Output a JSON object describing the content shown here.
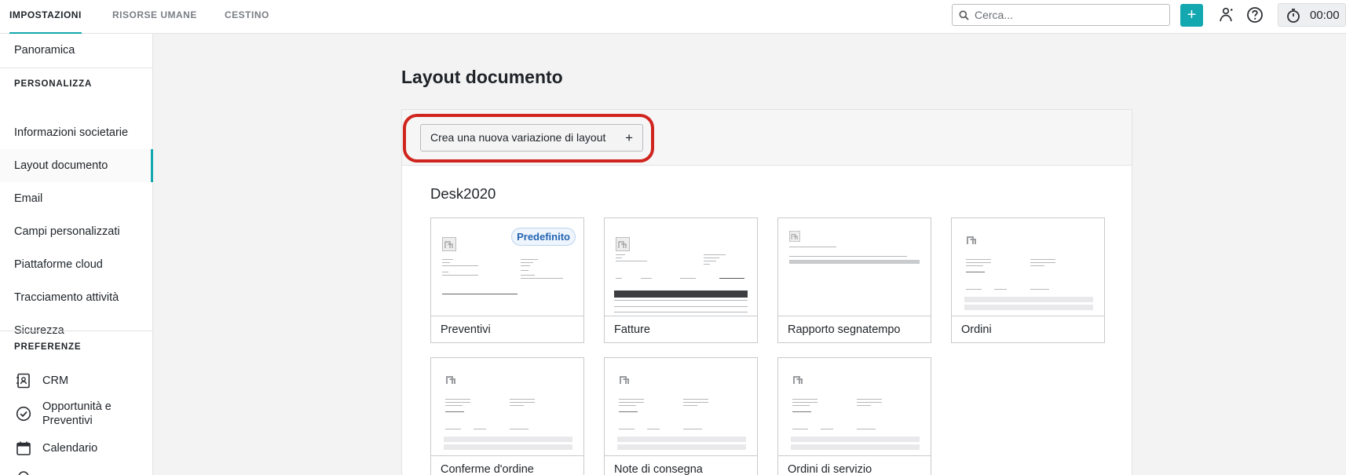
{
  "topbar": {
    "tabs": [
      {
        "label": "IMPOSTAZIONI",
        "active": true
      },
      {
        "label": "RISORSE UMANE",
        "active": false
      },
      {
        "label": "CESTINO",
        "active": false
      }
    ],
    "search_placeholder": "Cerca...",
    "add_label": "+",
    "timer": "00:00",
    "accent_color": "#13a8b0"
  },
  "sidebar": {
    "overview": "Panoramica",
    "customize_heading": "PERSONALIZZA",
    "customize_items": [
      "Informazioni societarie",
      "Layout documento",
      "Email",
      "Campi personalizzati",
      "Piattaforme cloud",
      "Tracciamento attività",
      "Sicurezza"
    ],
    "active_item": "Layout documento",
    "preferences_heading": "PREFERENZE",
    "preferences_items": [
      {
        "label": "CRM",
        "icon": "contacts-book-icon"
      },
      {
        "label": "Opportunità e Preventivi",
        "icon": "check-circle-icon"
      },
      {
        "label": "Calendario",
        "icon": "calendar-icon"
      }
    ]
  },
  "main": {
    "title": "Layout documento",
    "create_button": "Crea una nuova variazione di layout",
    "create_button_icon": "+",
    "highlight_color": "#d0251e",
    "group_title": "Desk2020",
    "default_badge": "Predefinito",
    "cards": [
      "Preventivi",
      "Fatture",
      "Rapporto segnatempo",
      "Ordini",
      "Conferme d'ordine",
      "Note di consegna",
      "Ordini di servizio"
    ]
  }
}
